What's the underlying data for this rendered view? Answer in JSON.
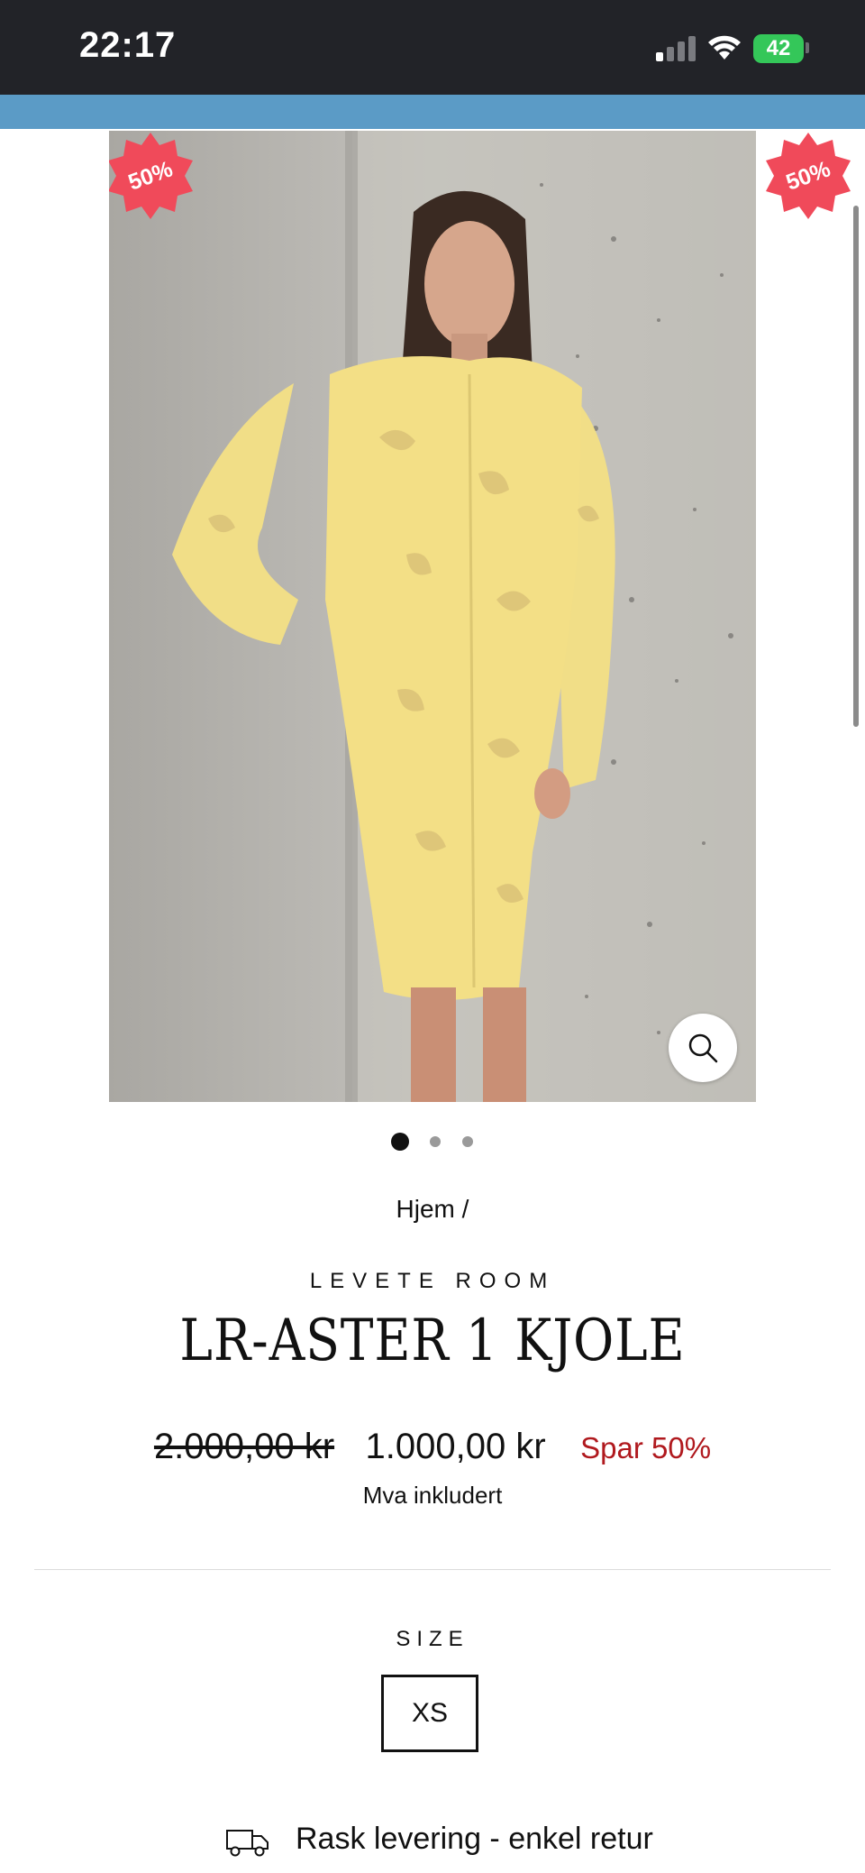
{
  "status_bar": {
    "time": "22:17",
    "battery": "42",
    "icons": [
      "cellular-signal-icon",
      "wifi-icon",
      "battery-charging-icon"
    ]
  },
  "product_image": {
    "badge_left": "50%",
    "badge_right": "50%",
    "icons": [
      "zoom-icon"
    ],
    "carousel_total": 3,
    "carousel_active": 1
  },
  "breadcrumb": "Hjem /",
  "product": {
    "brand": "LEVETE ROOM",
    "title": "LR-ASTER 1 KJOLE",
    "price_old": "2.000,00 kr",
    "price_new": "1.000,00 kr",
    "price_save": "Spar 50%",
    "vat_note": "Mva inkludert"
  },
  "size": {
    "label": "SIZE",
    "selected": "XS"
  },
  "delivery": {
    "icon": "truck-icon",
    "text": "Rask levering - enkel retur"
  },
  "colors": {
    "status_bar_bg": "#222328",
    "banner_blue": "#5b9bc6",
    "badge_red": "#f04a5a",
    "sale_red": "#b0191e",
    "dress_yellow": "#f3df86"
  }
}
